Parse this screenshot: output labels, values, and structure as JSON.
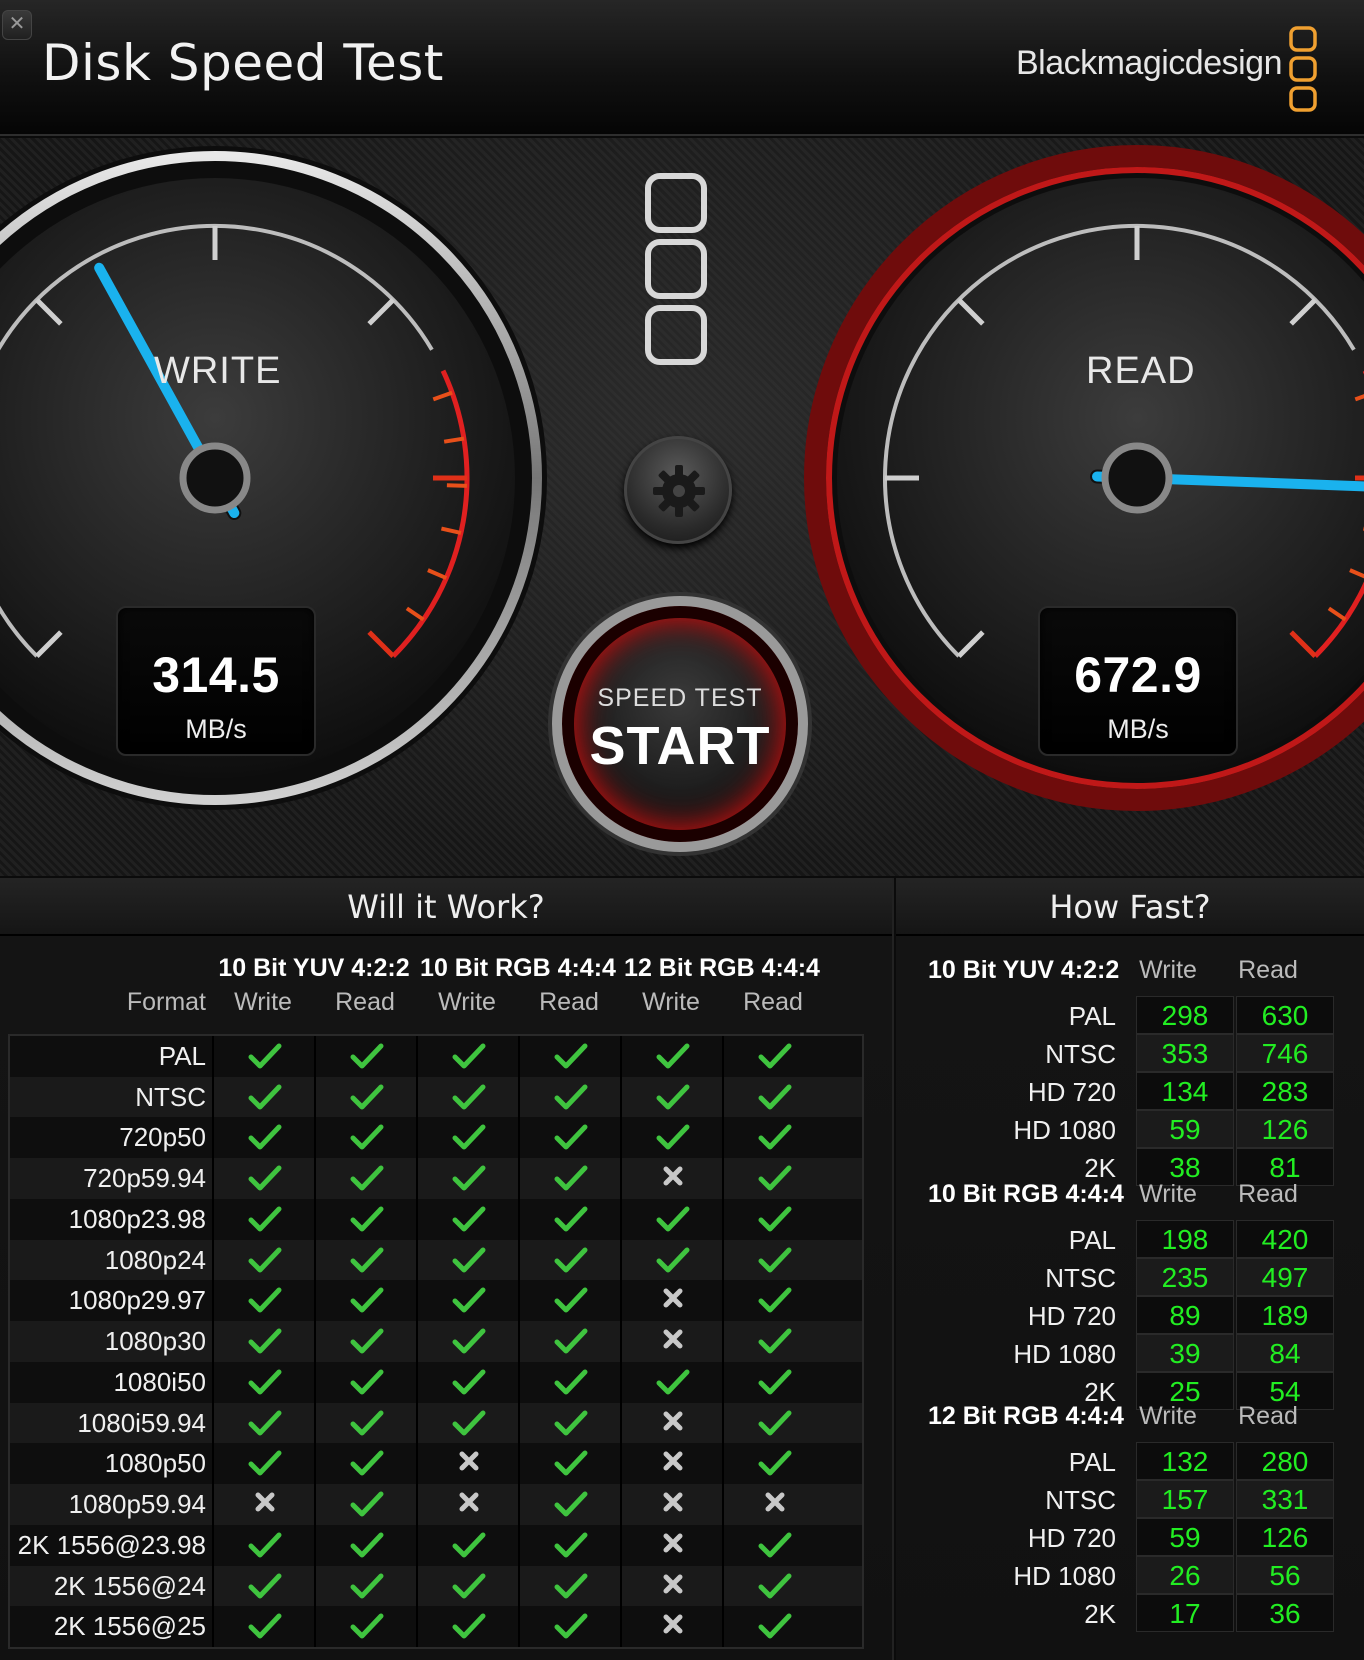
{
  "window": {
    "title": "Disk Speed Test",
    "brand": "Blackmagicdesign",
    "close_glyph": "✕"
  },
  "gauges": {
    "write": {
      "label": "WRITE",
      "value": "314.5",
      "unit": "MB/s",
      "speed_mbps": 314.5
    },
    "read": {
      "label": "READ",
      "value": "672.9",
      "unit": "MB/s",
      "speed_mbps": 672.9
    },
    "start": {
      "sub_label": "SPEED TEST",
      "label": "START"
    },
    "settings_icon": "gear-icon",
    "colors": {
      "needle": "#1ab2ee",
      "danger": "#e02020",
      "read_ring": "#8a1010"
    }
  },
  "will_it_work": {
    "title": "Will it Work?",
    "format_header": "Format",
    "groups": [
      {
        "name": "10 Bit YUV 4:2:2",
        "write": "Write",
        "read": "Read"
      },
      {
        "name": "10 Bit RGB 4:4:4",
        "write": "Write",
        "read": "Read"
      },
      {
        "name": "12 Bit RGB 4:4:4",
        "write": "Write",
        "read": "Read"
      }
    ],
    "rows": [
      {
        "format": "PAL",
        "cells": [
          1,
          1,
          1,
          1,
          1,
          1
        ]
      },
      {
        "format": "NTSC",
        "cells": [
          1,
          1,
          1,
          1,
          1,
          1
        ]
      },
      {
        "format": "720p50",
        "cells": [
          1,
          1,
          1,
          1,
          1,
          1
        ]
      },
      {
        "format": "720p59.94",
        "cells": [
          1,
          1,
          1,
          1,
          0,
          1
        ]
      },
      {
        "format": "1080p23.98",
        "cells": [
          1,
          1,
          1,
          1,
          1,
          1
        ]
      },
      {
        "format": "1080p24",
        "cells": [
          1,
          1,
          1,
          1,
          1,
          1
        ]
      },
      {
        "format": "1080p29.97",
        "cells": [
          1,
          1,
          1,
          1,
          0,
          1
        ]
      },
      {
        "format": "1080p30",
        "cells": [
          1,
          1,
          1,
          1,
          0,
          1
        ]
      },
      {
        "format": "1080i50",
        "cells": [
          1,
          1,
          1,
          1,
          1,
          1
        ]
      },
      {
        "format": "1080i59.94",
        "cells": [
          1,
          1,
          1,
          1,
          0,
          1
        ]
      },
      {
        "format": "1080p50",
        "cells": [
          1,
          1,
          0,
          1,
          0,
          1
        ]
      },
      {
        "format": "1080p59.94",
        "cells": [
          0,
          1,
          0,
          1,
          0,
          0
        ]
      },
      {
        "format": "2K 1556@23.98",
        "cells": [
          1,
          1,
          1,
          1,
          0,
          1
        ]
      },
      {
        "format": "2K 1556@24",
        "cells": [
          1,
          1,
          1,
          1,
          0,
          1
        ]
      },
      {
        "format": "2K 1556@25",
        "cells": [
          1,
          1,
          1,
          1,
          0,
          1
        ]
      }
    ]
  },
  "how_fast": {
    "title": "How Fast?",
    "groups": [
      {
        "name": "10 Bit YUV 4:2:2",
        "write": "Write",
        "read": "Read",
        "rows": [
          {
            "format": "PAL",
            "write": "298",
            "read": "630"
          },
          {
            "format": "NTSC",
            "write": "353",
            "read": "746"
          },
          {
            "format": "HD 720",
            "write": "134",
            "read": "283"
          },
          {
            "format": "HD 1080",
            "write": "59",
            "read": "126"
          },
          {
            "format": "2K",
            "write": "38",
            "read": "81"
          }
        ]
      },
      {
        "name": "10 Bit RGB 4:4:4",
        "write": "Write",
        "read": "Read",
        "rows": [
          {
            "format": "PAL",
            "write": "198",
            "read": "420"
          },
          {
            "format": "NTSC",
            "write": "235",
            "read": "497"
          },
          {
            "format": "HD 720",
            "write": "89",
            "read": "189"
          },
          {
            "format": "HD 1080",
            "write": "39",
            "read": "84"
          },
          {
            "format": "2K",
            "write": "25",
            "read": "54"
          }
        ]
      },
      {
        "name": "12 Bit RGB 4:4:4",
        "write": "Write",
        "read": "Read",
        "rows": [
          {
            "format": "PAL",
            "write": "132",
            "read": "280"
          },
          {
            "format": "NTSC",
            "write": "157",
            "read": "331"
          },
          {
            "format": "HD 720",
            "write": "59",
            "read": "126"
          },
          {
            "format": "HD 1080",
            "write": "26",
            "read": "56"
          },
          {
            "format": "2K",
            "write": "17",
            "read": "36"
          }
        ]
      }
    ]
  }
}
